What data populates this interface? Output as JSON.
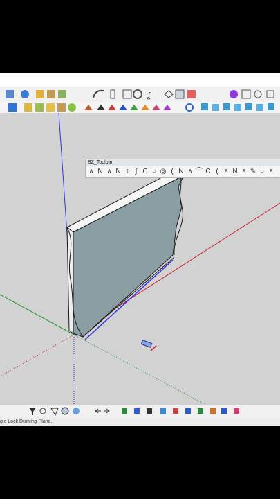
{
  "bz_toolbar": {
    "title": "BZ_Toolbar"
  },
  "status": {
    "text": "gle Lock Drawing Plane."
  },
  "colors": {
    "toolbar_bg": "#f0f0f0",
    "viewport_bg": "#d2d2d2",
    "face": "#8a9ea3",
    "edge": "#1a1a1a",
    "axis_blue": "#3333dd",
    "axis_red": "#cc2233",
    "axis_green": "#2a9a3a"
  },
  "icons": {
    "top_row": [
      "select-icon",
      "paint-icon",
      "components-icon",
      "materials-icon",
      "styles-icon",
      "arc-icon",
      "pan-icon",
      "orbit-icon",
      "settings-icon",
      "section-icon",
      "extension-icon",
      "view-icon",
      "box-icon",
      "search-icon",
      "camera-icon",
      "display-icon",
      "close-icon"
    ],
    "second_row": [
      "layer-icon",
      "cube-icon",
      "group-icon",
      "tag-icon",
      "terrain-icon",
      "sandbox-icon",
      "export-icon",
      "import-icon",
      "gear-icon",
      "scene-icon"
    ],
    "bottom_row": [
      "funnel-icon",
      "lasso-icon",
      "select-icon",
      "sphere-icon",
      "gear-icon",
      "arrows-icon",
      "axis-icon",
      "align-icon",
      "mirror-icon",
      "scale-icon",
      "text-icon"
    ]
  }
}
